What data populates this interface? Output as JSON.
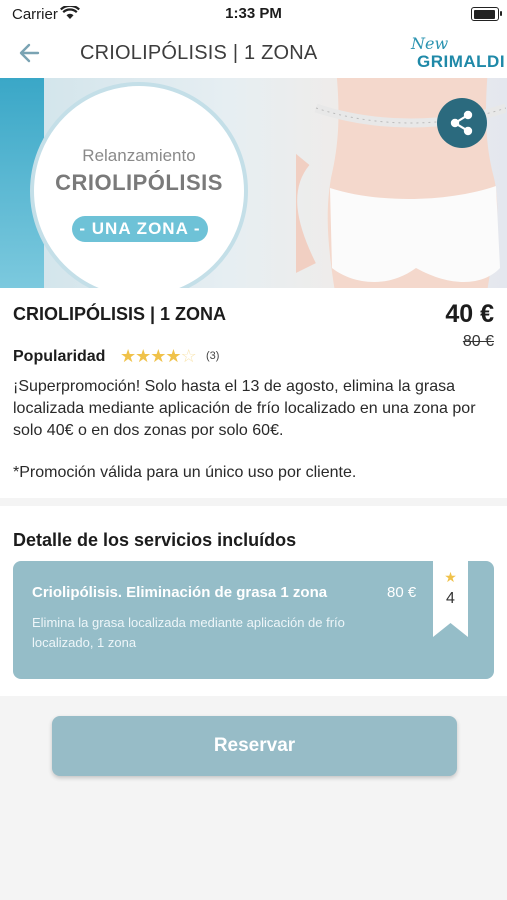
{
  "status_bar": {
    "carrier": "Carrier",
    "time": "1:33 PM"
  },
  "header": {
    "title": "CRIOLIPÓLISIS | 1 ZONA",
    "logo_script": "New",
    "logo_brand": "GRIMALDI"
  },
  "banner": {
    "line1": "Relanzamiento",
    "line2": "CRIOLIPÓLISIS",
    "pill": "- UNA ZONA -"
  },
  "product": {
    "title": "CRIOLIPÓLISIS | 1 ZONA",
    "price": "40 €",
    "old_price": "80 €",
    "popularity_label": "Popularidad",
    "rating": 4,
    "rating_max": 5,
    "rating_count": "(3)",
    "description": "¡Superpromoción! Solo hasta el 13 de agosto, elimina la grasa localizada mediante aplicación de frío localizado en una zona por solo 40€ o en dos zonas por solo 60€.",
    "note": "*Promoción válida para un único uso por cliente."
  },
  "services": {
    "title": "Detalle de los servicios incluídos",
    "items": [
      {
        "name": "Criolipólisis. Eliminación de grasa 1 zona",
        "price": "80 €",
        "description": "Elimina la grasa localizada mediante aplicación de frío localizado, 1 zona",
        "badge_value": "4"
      }
    ]
  },
  "actions": {
    "reserve_label": "Reservar"
  },
  "colors": {
    "accent": "#97bcc7",
    "share_bg": "#2b6a7e",
    "star": "#f0c24a",
    "brand": "#1f89a8"
  },
  "icons": {
    "back": "arrow-left-icon",
    "share": "share-icon",
    "star": "star-icon",
    "wifi": "wifi-icon",
    "battery": "battery-icon"
  }
}
